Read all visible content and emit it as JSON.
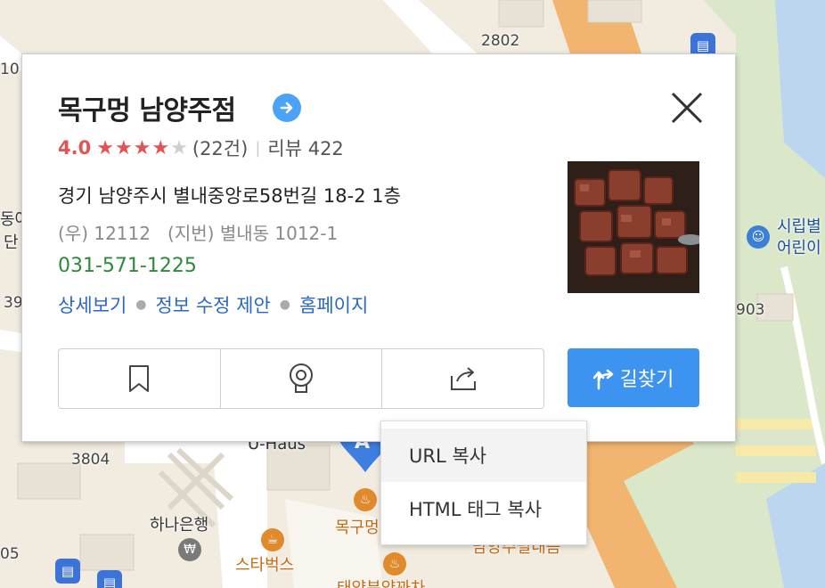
{
  "map": {
    "labels": {
      "road_2802": "2802",
      "road_3804": "3804",
      "road_903": "903",
      "road_39": "39",
      "road_10": "10",
      "road_05": "05",
      "edge_left_1": "동아",
      "edge_left_2": "단",
      "uhaus": "U-Haus",
      "bank": "하나은행",
      "starbucks": "스타벅스",
      "restaurant_short": "목구멍",
      "restaurant_partial": "남양주밀내음",
      "bottom_partial": "태양분양꽈차",
      "daycare_1": "시립별",
      "daycare_2": "어린이"
    },
    "marker_letter": "A",
    "won_symbol": "₩"
  },
  "place": {
    "name": "목구멍 남양주점",
    "rating": "4.0",
    "stars_full": 4,
    "stars_total": 5,
    "rating_count": "(22건)",
    "review_label": "리뷰 422",
    "address": "경기 남양주시 별내중앙로58번길 18-2 1층",
    "postal_jibun": "(우) 12112   (지번) 별내동 1012-1",
    "phone": "031-571-1225",
    "links": {
      "detail": "상세보기",
      "suggest": "정보 수정 제안",
      "homepage": "홈페이지"
    },
    "route_label": "길찾기"
  },
  "share_menu": {
    "items": [
      "URL 복사",
      "HTML 태그 복사"
    ]
  },
  "colors": {
    "accent_blue": "#3d93f0",
    "rating_red": "#e25454",
    "phone_green": "#2c8a3b",
    "link_blue": "#2a67c7"
  }
}
